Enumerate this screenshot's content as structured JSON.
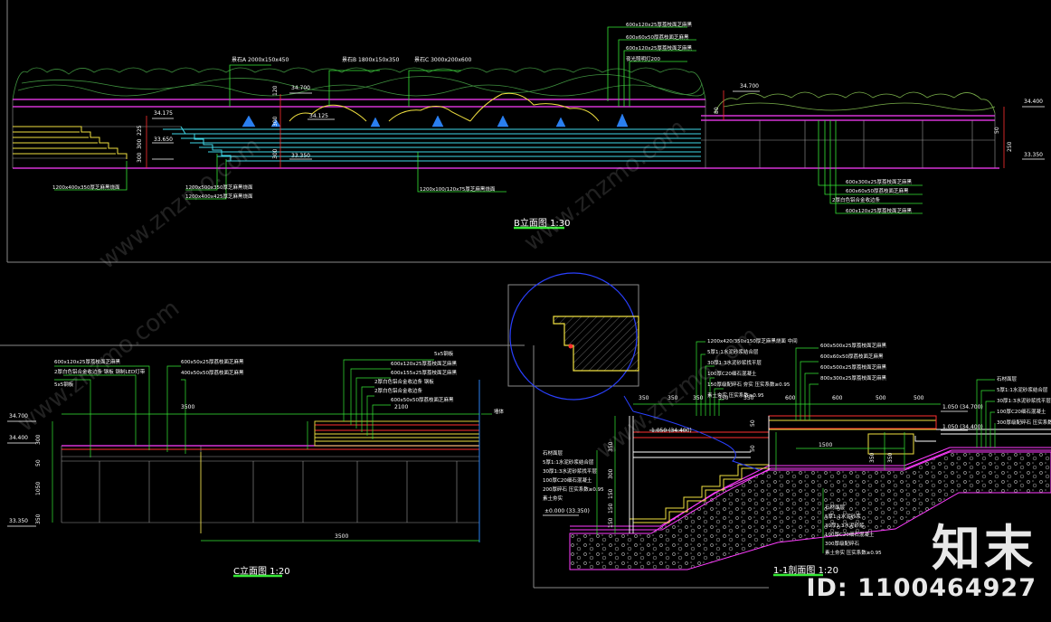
{
  "titles": {
    "b_elev": "B立面图 1:30",
    "c_elev": "C立面图 1:20",
    "section": "1-1剖面图 1:20"
  },
  "b_elev": {
    "top_labels": [
      "600x120x25厚荔枝面芝麻黑",
      "600x60x50厚荔枝面芝麻黑",
      "600x120x25厚荔枝面芝麻黑",
      "夜光照明灯200"
    ],
    "rock_labels": [
      "景石A 2000x150x450",
      "景石B 1800x150x350",
      "景石C 3000x200x600"
    ],
    "levels": [
      "34.700",
      "34.175",
      "34.125",
      "33.650",
      "33.350",
      "34.700",
      "34.400",
      "33.350"
    ],
    "dims_left": [
      "225",
      "300",
      "500",
      "300"
    ],
    "dims_mid": [
      "120",
      "150",
      "300",
      "150",
      "300"
    ],
    "dims_right": [
      "50",
      "80",
      "250"
    ],
    "bottom_labels": [
      "1200x400x350厚芝麻黑烧面",
      "1200x500x350厚芝麻黑烧面",
      "1200x400x425厚芝麻黑烧面",
      "1200x100/120x75厚芝麻黑烧面"
    ],
    "right_labels": [
      "600x300x25厚荔枝面芝麻黑",
      "600x60x50厚荔枝面芝麻黑",
      "2厚白色铝合金收边条",
      "600x120x25厚荔枝面芝麻黑"
    ]
  },
  "c_elev": {
    "labels_left": [
      "600x120x25厚荔枝面芝麻黑",
      "2厚白色铝合金收边条 钢板 钢制LED灯带",
      "5x5钢板"
    ],
    "labels_mid": [
      "600x50x25厚荔枝面芝麻黑",
      "400x50x50厚荔枝面芝麻黑"
    ],
    "labels_right": [
      "5x5钢板",
      "600x120x25厚荔枝面芝麻黑",
      "600x155x25厚荔枝面芝麻黑",
      "2厚白色铝合金收边条 钢板",
      "2厚白色铝合金收边条",
      "600x50x50厚荔枝面芝麻黑"
    ],
    "end_label": "墙体",
    "levels": [
      "34.700",
      "34.400",
      "33.350"
    ],
    "dims": [
      "3500",
      "2100",
      "3500",
      "30",
      "300",
      "50",
      "1050",
      "350",
      "50"
    ]
  },
  "section": {
    "top_labels": [
      "1200x420/350x150厚芝麻黑烧面 中间",
      "5厚1:1水泥砂浆结合层",
      "30厚1:3水泥砂浆找平层",
      "100厚C20细石混凝土",
      "150厚级配碎石 夯实 压实系数≥0.95",
      "素土夯实 压实系数≥0.95"
    ],
    "top_right_labels": [
      "600x500x25厚荔枝面芝麻黑",
      "600x60x50厚荔枝面芝麻黑",
      "600x500x25厚荔枝面芝麻黑",
      "800x300x25厚荔枝面芝麻黑"
    ],
    "dims_top": [
      "350",
      "350",
      "350",
      "350",
      "350",
      "600",
      "600",
      "500",
      "500"
    ],
    "levels": [
      "1.050 (34.400)",
      "1.050 (34.700)",
      "1.050 (34.400)",
      "±0.000 (33.350)"
    ],
    "left_labels": [
      "石材面层",
      "5厚1:1水泥砂浆结合层",
      "30厚1:3水泥砂浆找平层",
      "100厚C20细石混凝土",
      "200厚碎石 压实系数≥0.95",
      "素土夯实"
    ],
    "right_labels_top": [
      "石材面层",
      "5厚1:1水泥砂浆结合层",
      "30厚1:3水泥砂浆找平层",
      "100厚C20细石混凝土",
      "300厚级配碎石 压实系数≥0.95"
    ],
    "right_labels_bottom": [
      "石材面层",
      "5厚1:1水泥砂浆",
      "30厚1:3水泥砂浆",
      "100厚C20细石混凝土",
      "300厚级配碎石",
      "素土夯实 压实系数≥0.95"
    ],
    "dims_left": [
      "350",
      "300",
      "150",
      "150",
      "150"
    ],
    "dims_mid": [
      "1500",
      "350",
      "350",
      "50",
      "50"
    ]
  },
  "watermark": "www.znzmo.com",
  "brand": {
    "logo": "知末",
    "id": "ID: 1100464927"
  }
}
